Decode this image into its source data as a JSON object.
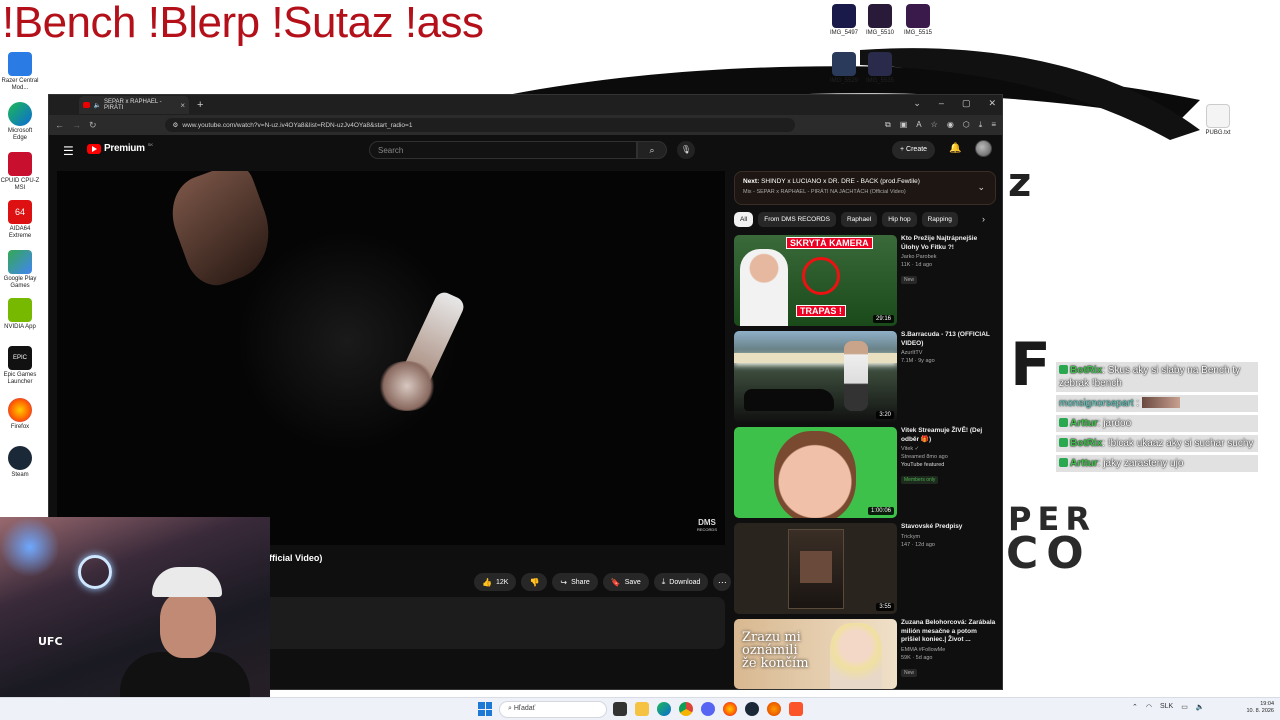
{
  "overlay": {
    "commands": "!Bench !Blerp !Sutaz !ass"
  },
  "desktop": {
    "icons_left": [
      "Razer Central\nMod...",
      "Microsoft\nEdge",
      "CPUID\nCPU-Z MSI",
      "AIDA64\nExtreme",
      "Google Play\nGames",
      "NVIDIA App",
      "Epic Games\nLauncher",
      "Firefox",
      "Steam"
    ],
    "icons_right": [
      "IMG_5497",
      "IMG_5510",
      "IMG_5515",
      "IMG_5529",
      "IMG_5535",
      "PUBG.txt"
    ]
  },
  "browser": {
    "tab_title": "SEPAR x RAPHAEL - PIRÁTI",
    "url": "www.youtube.com/watch?v=N-uz.iv4OYa8&list=RDN-uzJv4OYa8&start_radio=1"
  },
  "youtube": {
    "logo_text": "Premium",
    "logo_sup": "SK",
    "search_placeholder": "Search",
    "create_label": "Create",
    "video_title_fragment": "fficial Video)",
    "watermark": "DMS",
    "watermark_sub": "RECORDS",
    "actions": {
      "likes": "12K",
      "share": "Share",
      "save": "Save",
      "download": "Download"
    },
    "next": {
      "label": "Next:",
      "title": "SHINDY x LUCIANO x DR. DRE - BACK (prod.Fewtile)",
      "mix": "Mix - SEPAR x RAPHAEL - PIRÁTI NA JACHTÁCH (Official Video)"
    },
    "chips": [
      "All",
      "From DMS RECORDS",
      "Raphael",
      "Hip hop",
      "Rapping"
    ],
    "recommendations": [
      {
        "title": "Kto Prežije Najtrápnejšie Úlohy Vo Fitku ?!",
        "channel": "Jarko Parobek",
        "stats": "11K · 1d ago",
        "badge": "New",
        "duration": "29:16",
        "thumb_text_top": "SKRYTÁ KAMERA",
        "thumb_text_bottom": "TRAPAS !"
      },
      {
        "title": "S.Barracuda - 713 (OFFICIAL VIDEO)",
        "channel": "AzurItTV",
        "stats": "7.1M · 9y ago",
        "duration": "3:20"
      },
      {
        "title": "Vitek Streamuje ŽIVĚ! (Dej odběr 🎁)",
        "channel": "Vitek ✓",
        "stats": "Streamed 8mo ago",
        "featured": "YouTube featured",
        "members": "Members only",
        "duration": "1:00:06"
      },
      {
        "title": "Stavovské Predpisy",
        "channel": "Trickym",
        "stats": "147 · 12d ago",
        "duration": "3:55"
      },
      {
        "title": "Zuzana Belohorcová: Zarábala milión mesačne a potom prišiel koniec.| Život ...",
        "channel": "EMMA #FollowMe",
        "stats": "59K · 5d ago",
        "badge": "New",
        "thumb_text": "Zrazu mi oznámili že končím"
      }
    ]
  },
  "chat": [
    {
      "user": "BotRix",
      "text": ": Skus aky si slaby na Bench ty zebrak !bench"
    },
    {
      "user": "monsignorsepart",
      "text": ":"
    },
    {
      "user": "Arttur",
      "text": ": jardoo"
    },
    {
      "user": "BotRix",
      "text": ": !bicak ukaaz aky si suchar suchy"
    },
    {
      "user": "Arttur",
      "text": ": jaky zarasteny ujo"
    }
  ],
  "webcam": {
    "shirt_text": "UFC"
  },
  "taskbar": {
    "search_placeholder": "Hľadať",
    "lang": "SLK",
    "time": "19:04",
    "date": "10. 8. 2026"
  },
  "colors": {
    "yt_red": "#ff0000",
    "overlay_red": "#b3101a",
    "chat_green": "#3ec24b"
  }
}
